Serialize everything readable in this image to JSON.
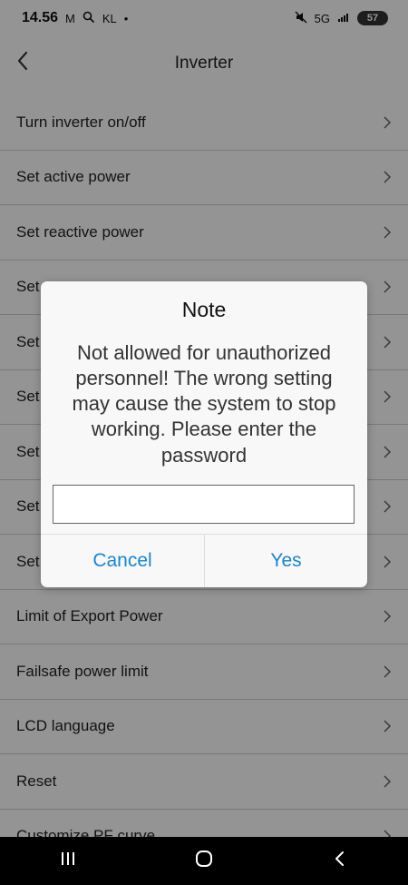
{
  "status_bar": {
    "time": "14.56",
    "left_indicators": [
      "M",
      "Q",
      "KL",
      "•"
    ],
    "network": "5G",
    "battery": "57"
  },
  "header": {
    "title": "Inverter",
    "back_icon": "chevron-left-icon"
  },
  "list": {
    "items": [
      {
        "label": "Turn inverter on/off",
        "icon": "chevron-right-icon"
      },
      {
        "label": "Set active power",
        "icon": "chevron-right-icon"
      },
      {
        "label": "Set reactive power",
        "icon": "chevron-right-icon"
      },
      {
        "label": "Set",
        "icon": "chevron-right-icon"
      },
      {
        "label": "Set",
        "icon": "chevron-right-icon"
      },
      {
        "label": "Set",
        "icon": "chevron-right-icon"
      },
      {
        "label": "Set",
        "icon": "chevron-right-icon"
      },
      {
        "label": "Set (Hi",
        "icon": "chevron-right-icon"
      },
      {
        "label": "Set",
        "icon": "chevron-right-icon"
      },
      {
        "label": "Limit of Export Power",
        "icon": "chevron-right-icon"
      },
      {
        "label": "Failsafe power limit",
        "icon": "chevron-right-icon"
      },
      {
        "label": "LCD language",
        "icon": "chevron-right-icon"
      },
      {
        "label": "Reset",
        "icon": "chevron-right-icon"
      },
      {
        "label": "Customize PF curve",
        "icon": "chevron-right-icon"
      }
    ]
  },
  "dialog": {
    "title": "Note",
    "message": "Not allowed for unauthorized personnel! The wrong setting may cause the system to stop working. Please enter the password",
    "password_value": "",
    "cancel_label": "Cancel",
    "yes_label": "Yes"
  },
  "colors": {
    "accent": "#1786d4",
    "overlay": "#000000",
    "nav_bar": "#000000"
  },
  "nav_bar": {
    "icons": [
      "recent-apps-icon",
      "home-icon",
      "back-icon"
    ]
  }
}
